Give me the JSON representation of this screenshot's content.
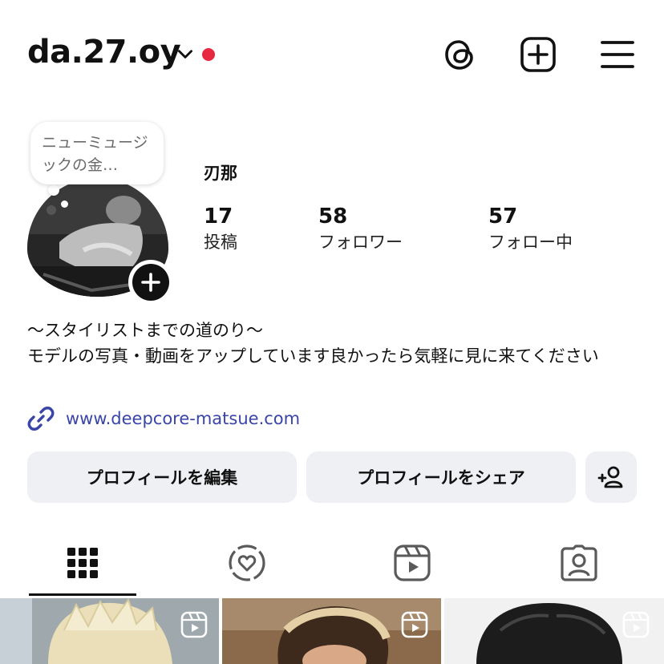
{
  "header": {
    "username": "da.27.oy",
    "icons": [
      "threads-icon",
      "create-post-icon",
      "menu-icon"
    ]
  },
  "profile": {
    "note": "ニューミュージックの金…",
    "display_name": "刃那",
    "stats": [
      {
        "value": "17",
        "label": "投稿"
      },
      {
        "value": "58",
        "label": "フォロワー"
      },
      {
        "value": "57",
        "label": "フォロー中"
      }
    ],
    "bio_line1": "〜スタイリストまでの道のり〜",
    "bio_line2": "モデルの写真・動画をアップしています良かったら気軽に見に来てください",
    "link": "www.deepcore-matsue.com"
  },
  "buttons": {
    "edit": "プロフィールを編集",
    "share": "プロフィールをシェア"
  },
  "tabs": [
    "grid-icon",
    "highlights-icon",
    "reels-icon",
    "tagged-icon"
  ],
  "colors": {
    "link": "#3945a8",
    "notification_dot": "#e8283f",
    "button_bg": "#eef0f3"
  }
}
